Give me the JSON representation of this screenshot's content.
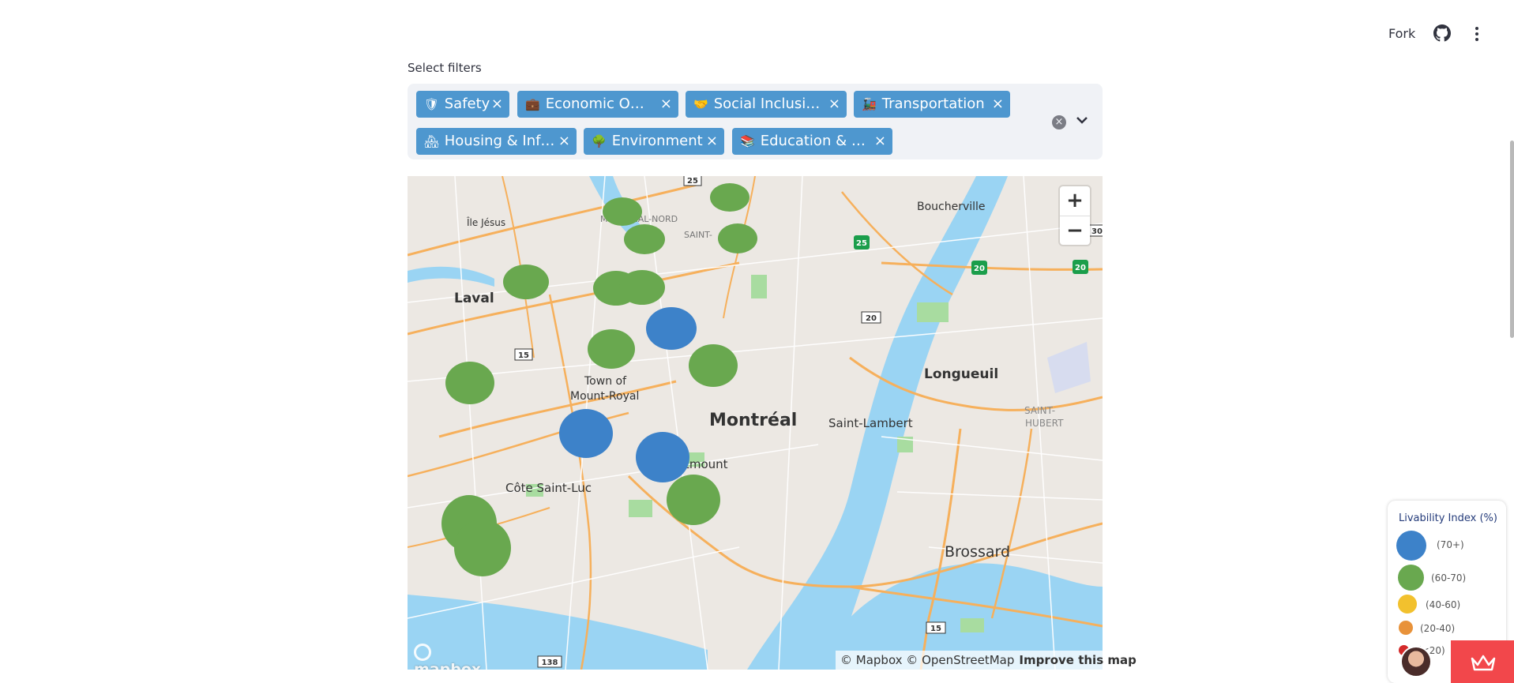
{
  "header": {
    "fork_label": "Fork",
    "github_icon": "github-icon",
    "menu_icon": "kebab-menu-icon"
  },
  "filters": {
    "label": "Select filters",
    "chips": [
      {
        "icon": "🛡",
        "label": "Safety"
      },
      {
        "icon": "💼",
        "label": "Economic O…"
      },
      {
        "icon": "🤝",
        "label": "Social Inclusi…"
      },
      {
        "icon": "🚂",
        "label": "Transportation"
      },
      {
        "icon": "🏘",
        "label": "Housing & Inf…"
      },
      {
        "icon": "🌳",
        "label": "Environment"
      },
      {
        "icon": "📚",
        "label": "Education & …"
      }
    ],
    "chip_color": "#4e97cf"
  },
  "map": {
    "place_labels": [
      "Île Jésus",
      "MONTRÉAL-NORD",
      "SAINT-",
      "Boucherville",
      "Laval",
      "Town of",
      "Mount-Royal",
      "Montréal",
      "Longueuil",
      "Saint-Lambert",
      "SAINT-",
      "HUBERT",
      "Westmount",
      "Côte Saint-Luc",
      "Brossard"
    ],
    "route_shields": [
      "25",
      "25",
      "30",
      "20",
      "20",
      "20",
      "15",
      "15",
      "138"
    ],
    "zoom_in": "+",
    "zoom_out": "−",
    "attribution": "© Mapbox © OpenStreetMap",
    "improve": "Improve this map",
    "logo": "mapbox"
  },
  "markers": {
    "colors": {
      "70+": "#3d82c9",
      "60-70": "#69a84f"
    },
    "points": [
      {
        "cat": "60-70"
      },
      {
        "cat": "60-70"
      },
      {
        "cat": "60-70"
      },
      {
        "cat": "60-70"
      },
      {
        "cat": "60-70"
      },
      {
        "cat": "60-70"
      },
      {
        "cat": "60-70"
      },
      {
        "cat": "70+"
      },
      {
        "cat": "60-70"
      },
      {
        "cat": "60-70"
      },
      {
        "cat": "60-70"
      },
      {
        "cat": "70+"
      },
      {
        "cat": "70+"
      },
      {
        "cat": "60-70"
      },
      {
        "cat": "60-70"
      },
      {
        "cat": "60-70"
      }
    ]
  },
  "legend": {
    "title": "Livability Index (%)",
    "items": [
      {
        "label": "(70+)",
        "color": "#3d82c9"
      },
      {
        "label": "(60-70)",
        "color": "#69a84f"
      },
      {
        "label": "(40-60)",
        "color": "#f2c12e"
      },
      {
        "label": "(20-40)",
        "color": "#e8923a"
      },
      {
        "label": "(<20)",
        "color": "#d42a2a"
      }
    ]
  }
}
